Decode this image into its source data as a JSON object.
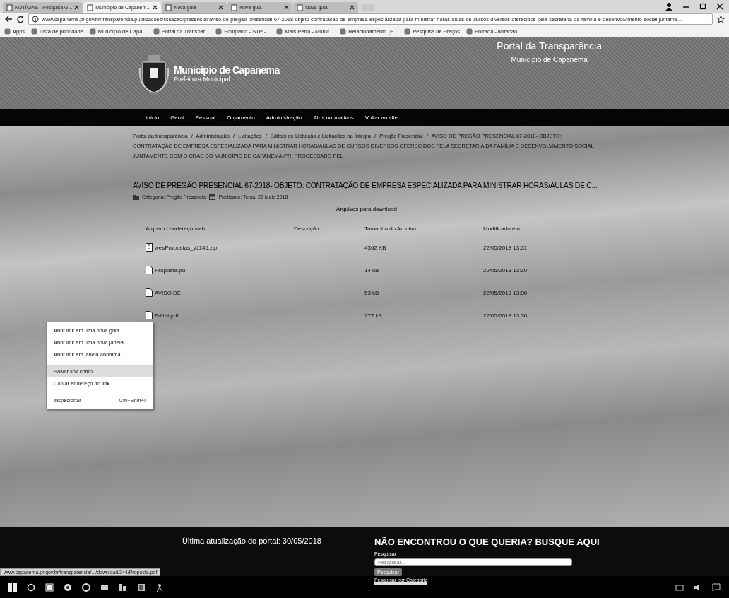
{
  "browser": {
    "tabs": [
      {
        "title": "NOTÍCIAS - Pesquisa G...",
        "selected": false
      },
      {
        "title": "Município de Capanem...",
        "selected": true
      },
      {
        "title": "Nova guia",
        "selected": false
      },
      {
        "title": "Nova guia",
        "selected": false
      },
      {
        "title": "Nova guia",
        "selected": false
      }
    ],
    "url": "www.capanema.pr.gov.br/transparencia/publicacoes/licitacao/presencial/aviso-de-pregao-presencial-67-2018-objeto-contratacao-de-empresa-especializada-para-ministrar-horas-aulas-de-cursos-diversos-oferecidos-pela-secretaria-da-familia-e-desenvolvimento-social-juntame...",
    "bookmarks": [
      "Apps",
      "Lista de prioridade",
      "Município de Capa...",
      "Portal da Transpar...",
      "Equiplano - STP -...",
      "Mais Perto - Munic...",
      "Relacionamento (E...",
      "Pesquisa de Preços",
      "Entrada - licitacao..."
    ]
  },
  "site_header": {
    "title": "Município de Capanema",
    "subtitle": "Prefeitura Municipal",
    "portal_title": "Portal da Transparência",
    "portal_subtitle": "Município de Capanema"
  },
  "nav": [
    "Início",
    "Geral",
    "Pessoal",
    "Orçamento",
    "Administração",
    "Atos normativos",
    "Voltar ao site"
  ],
  "breadcrumb": [
    {
      "kind": "link",
      "text": "Portal da transparência"
    },
    {
      "kind": "separator",
      "text": "/"
    },
    {
      "kind": "link",
      "text": "Administração"
    },
    {
      "kind": "separator",
      "text": "/"
    },
    {
      "kind": "link",
      "text": "Licitações"
    },
    {
      "kind": "separator",
      "text": "/"
    },
    {
      "kind": "link",
      "text": "Editais de Licitação e Licitações na Íntegra"
    },
    {
      "kind": "separator",
      "text": "/"
    },
    {
      "kind": "link",
      "text": "Pregão Presencial"
    },
    {
      "kind": "separator",
      "text": "/"
    },
    {
      "kind": "current",
      "text": "AVISO DE PREGÃO PRESENCIAL 67-2018- OBJETO: CONTRATAÇÃO DE EMPRESA ESPECIALIZADA PARA MINISTRAR HORAS/AULAS DE CURSOS DIVERSOS OFERECIDOS PELA SECRETARIA DA FAMÍLIA E DESENVOLVIMENTO SOCIAL JUNTAMENTE COM O CRAS DO MUNICÍPIO DE CAPANEMA-PR, PROCESSADO PEL"
    }
  ],
  "article": {
    "title": "AVISO DE PREGÃO PRESENCIAL 67-2018- OBJETO: CONTRATAÇÃO DE EMPRESA ESPECIALIZADA PARA MINISTRAR HORAS/AULAS DE C...",
    "category": "Categoria: Pregão Presencial",
    "published": "Publicado: Terça, 22 Maio 2018"
  },
  "downloads": {
    "caption": "Arquivos para download",
    "columns": [
      "Arquivo / endereço web",
      "Descrição",
      "Tamanho do Arquivo",
      "Modificado em"
    ],
    "rows": [
      {
        "kind": "zip",
        "file": "wesPropostas_v1145.zip",
        "size": "4362 KB",
        "modified": "22/05/2018 13:31"
      },
      {
        "kind": "pdf",
        "file": "Proposta.pd",
        "size": "14 kB",
        "modified": "22/05/2018 13:30"
      },
      {
        "kind": "pdf",
        "file": "AVISO DE",
        "size": "53 kB",
        "modified": "22/05/2018 13:30"
      },
      {
        "kind": "pdf",
        "file": "Edital.pdf",
        "size": "277 kB",
        "modified": "22/05/2018 13:30"
      }
    ]
  },
  "context_menu": [
    {
      "label": "Abrir link em uma nova guia",
      "selected": false
    },
    {
      "label": "Abrir link em uma nova janela",
      "selected": false
    },
    {
      "label": "Abrir link em janela anônima",
      "selected": false,
      "divider_after": true
    },
    {
      "label": "Salvar link como...",
      "selected": true
    },
    {
      "label": "Copiar endereço do link",
      "selected": false,
      "divider_after": true
    },
    {
      "label": "Inspecionar",
      "shortcut": "Ctrl+Shift+I",
      "selected": false
    }
  ],
  "footer": {
    "updated": "Última atualização do portal: 30/05/2018",
    "search_heading": "NÃO ENCONTROU O QUE QUERIA? BUSQUE AQUI",
    "search_label": "Pesquisar",
    "placeholder": "Pesquisar...",
    "button": "Pesquisar",
    "category_link": "Pesquisar por Categoria"
  },
  "status_bar": "www.capanema.pr.gov.br/transparencia/.../download/344/Proposta.pdf"
}
